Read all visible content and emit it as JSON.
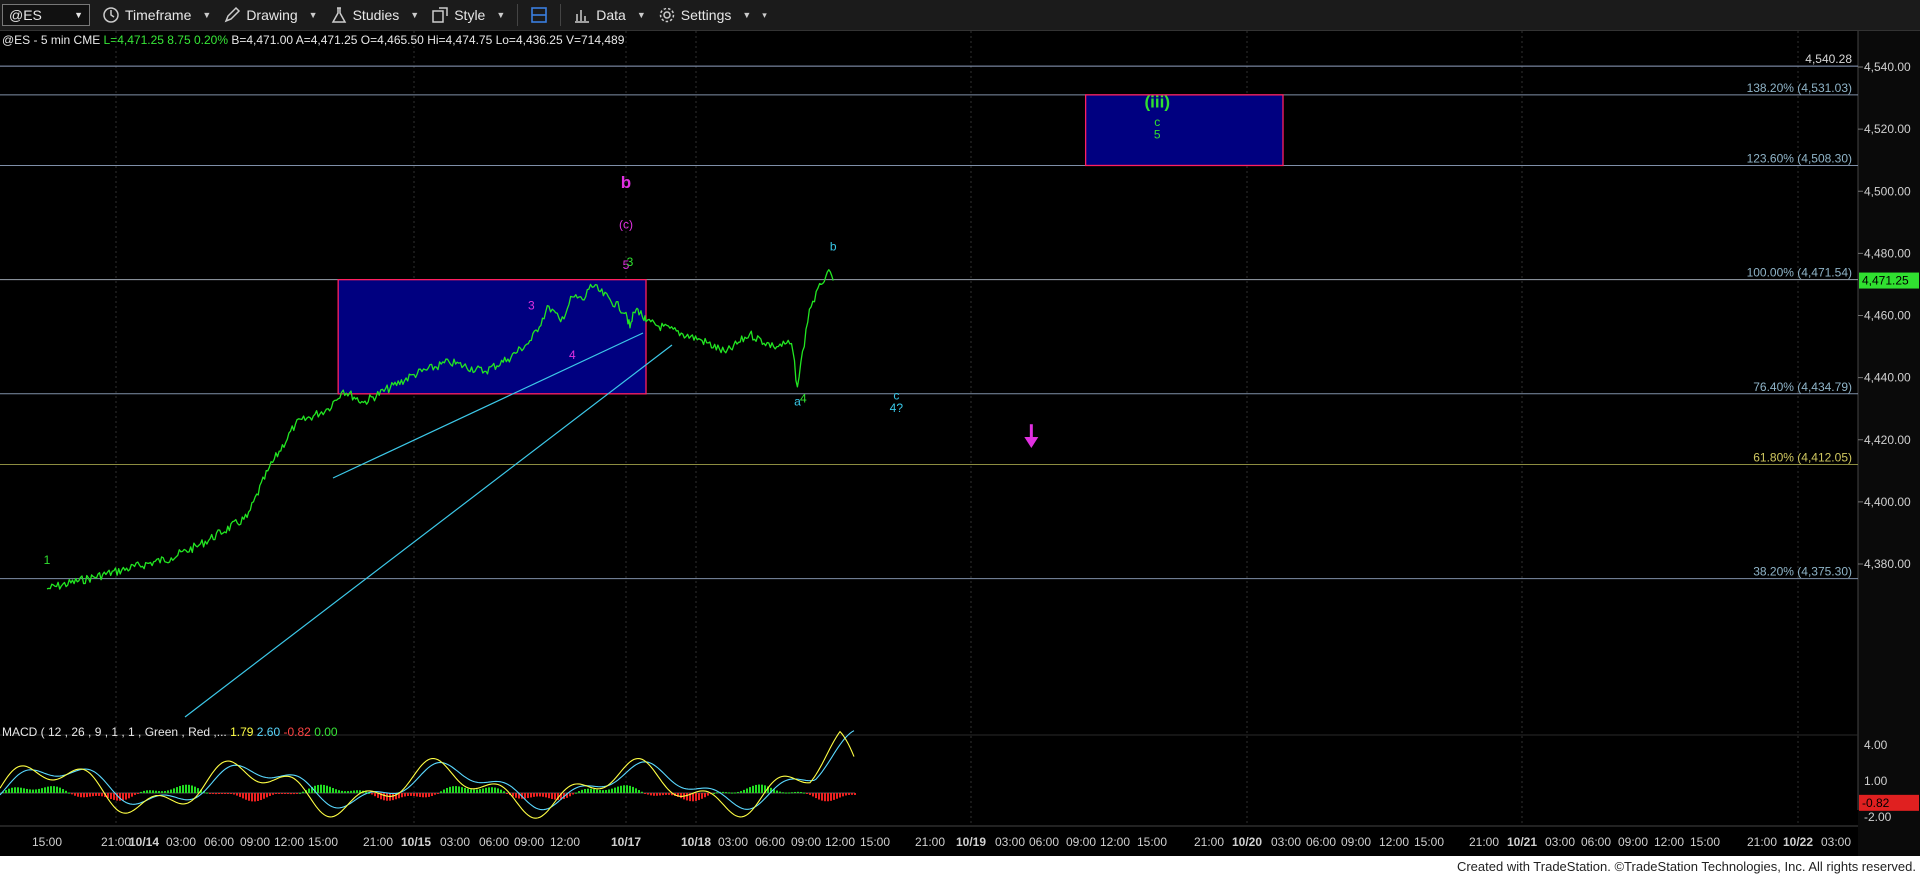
{
  "toolbar": {
    "symbol": "@ES",
    "timeframe": "Timeframe",
    "drawing": "Drawing",
    "studies": "Studies",
    "style": "Style",
    "data": "Data",
    "settings": "Settings"
  },
  "status_line": {
    "parts": [
      {
        "text": "@ES - 5 min  CME",
        "color": "#e8e8e8"
      },
      {
        "text": "L=4,471.25",
        "color": "#37e637"
      },
      {
        "text": "8.75",
        "color": "#37e637"
      },
      {
        "text": "0.20%",
        "color": "#37e637"
      },
      {
        "text": "B=4,471.00",
        "color": "#e8e8e8"
      },
      {
        "text": "A=4,471.25",
        "color": "#e8e8e8"
      },
      {
        "text": "O=4,465.50",
        "color": "#e8e8e8"
      },
      {
        "text": "Hi=4,474.75",
        "color": "#e8e8e8"
      },
      {
        "text": "Lo=4,436.25",
        "color": "#e8e8e8"
      },
      {
        "text": "V=714,489",
        "color": "#e8e8e8"
      }
    ]
  },
  "macd_line": {
    "parts": [
      {
        "text": "MACD ( 12 , 26 , 9 , 1 , 1 , Green , Red ,...",
        "color": "#e8e8e8"
      },
      {
        "text": "1.79",
        "color": "#ffff44"
      },
      {
        "text": "2.60",
        "color": "#5ad8ff"
      },
      {
        "text": "-0.82",
        "color": "#ff4444"
      },
      {
        "text": "0.00",
        "color": "#37e637"
      }
    ]
  },
  "footer": "Created with TradeStation. ©TradeStation Technologies, Inc. All rights reserved.",
  "colors": {
    "price": "#22e622",
    "fib_line": "#7f8fa8",
    "fib_gold": "#8c8c40",
    "wedge": "#3cc8e8",
    "box_fill": "#000080",
    "box_border": "#ff2060",
    "magenta": "#e030e0",
    "green_label": "#30e030",
    "cyan_label": "#38c8e8",
    "macd_line": "#ffff44",
    "macd_signal": "#5ad8ff",
    "hist_pos": "#22dd22",
    "hist_neg": "#ee2020"
  },
  "chart_data": {
    "type": "line",
    "title": "@ES - 5 min CME",
    "price_axis": {
      "ylim": [
        4365,
        4548
      ],
      "ticks": [
        "4,540.00",
        "4,520.00",
        "4,500.00",
        "4,480.00",
        "4,460.00",
        "4,440.00",
        "4,420.00",
        "4,400.00",
        "4,380.00"
      ]
    },
    "last_price": "4,471.25",
    "time_axis_labels": [
      "15:00",
      "21:00",
      "10/14",
      "03:00",
      "06:00",
      "09:00",
      "12:00",
      "15:00",
      "21:00",
      "10/15",
      "03:00",
      "06:00",
      "09:00",
      "12:00",
      "10/17",
      "10/18",
      "03:00",
      "06:00",
      "09:00",
      "12:00",
      "15:00",
      "21:00",
      "10/19",
      "03:00",
      "06:00",
      "09:00",
      "12:00",
      "15:00",
      "21:00",
      "10/20",
      "03:00",
      "06:00",
      "09:00",
      "12:00",
      "15:00",
      "21:00",
      "10/21",
      "03:00",
      "06:00",
      "09:00",
      "12:00",
      "15:00",
      "21:00",
      "10/22",
      "03:00"
    ],
    "series": [
      {
        "name": "@ES",
        "x": [
          "10/13 15:00",
          "10/14 04:00",
          "10/14 06:00",
          "10/14 09:30",
          "10/14 11:00",
          "10/14 13:00",
          "10/14 15:30",
          "10/14 17:00",
          "10/14 19:00",
          "10/15 00:00",
          "10/15 03:00",
          "10/15 06:00",
          "10/15 08:00",
          "10/15 10:00",
          "10/15 11:30",
          "10/15 12:30",
          "10/15 13:30",
          "10/15 14:30",
          "10/15 15:30",
          "10/17 00:00",
          "10/17 01:30",
          "10/17 03:00",
          "10/17 04:30",
          "10/17 06:00",
          "10/17 07:30",
          "10/18 00:30",
          "10/18 02:30",
          "10/18 04:30",
          "10/18 06:30",
          "10/18 08:00",
          "10/18 08:30",
          "10/18 09:30",
          "10/18 10:30",
          "10/18 11:00",
          "10/18 11:30"
        ],
        "values": [
          4372,
          4382,
          4386,
          4395,
          4410,
          4425,
          4430,
          4436,
          4432,
          4441,
          4445,
          4442,
          4446,
          4452,
          4463,
          4458,
          4466,
          4465,
          4470,
          4461,
          4456,
          4461,
          4462,
          4460,
          4458,
          4452,
          4448,
          4454,
          4450,
          4451,
          4437,
          4462,
          4470,
          4474,
          4471.25
        ]
      }
    ],
    "fib_levels": [
      {
        "label": "138.20% (4,531.03)",
        "value": 4531.03
      },
      {
        "label": "123.60% (4,508.30)",
        "value": 4508.3
      },
      {
        "label": "100.00% (4,471.54)",
        "value": 4471.54
      },
      {
        "label": "76.40% (4,434.79)",
        "value": 4434.79
      },
      {
        "label": "61.80% (4,412.05)",
        "value": 4412.05
      },
      {
        "label": "38.20% (4,375.30)",
        "value": 4375.3
      }
    ],
    "hline": {
      "label": "4,540.28",
      "value": 4540.28
    },
    "target_box": {
      "x": [
        "10/19 09:30",
        "10/20 03:00"
      ],
      "y": [
        4508.3,
        4531.03
      ]
    },
    "consolidation_box": {
      "x": [
        "10/14 16:30",
        "10/17 07:30"
      ],
      "y": [
        4434.79,
        4471.54
      ]
    },
    "annotations": [
      {
        "text": "1",
        "x": "10/13 15:00",
        "y": 4380,
        "color": "green"
      },
      {
        "text": "b",
        "x": "10/17 00:00",
        "y": 4501,
        "color": "magenta",
        "size": "large"
      },
      {
        "text": "(c)",
        "x": "10/17 00:00",
        "y": 4488,
        "color": "magenta"
      },
      {
        "text": "5",
        "x": "10/17 00:00",
        "y": 4475,
        "color": "magenta"
      },
      {
        "text": "3",
        "x": "10/17 01:30",
        "y": 4476,
        "color": "green"
      },
      {
        "text": "3",
        "x": "10/15 10:00",
        "y": 4462,
        "color": "magenta"
      },
      {
        "text": "4",
        "x": "10/15 13:30",
        "y": 4446,
        "color": "magenta"
      },
      {
        "text": "b",
        "x": "10/18 11:30",
        "y": 4481,
        "color": "cyan"
      },
      {
        "text": "a",
        "x": "10/18 08:30",
        "y": 4431,
        "color": "cyan"
      },
      {
        "text": "4",
        "x": "10/18 09:00",
        "y": 4432,
        "color": "green"
      },
      {
        "text": "c",
        "x": "10/18 17:00",
        "y": 4433,
        "color": "cyan"
      },
      {
        "text": "4?",
        "x": "10/18 17:00",
        "y": 4429,
        "color": "cyan"
      },
      {
        "text": "(iii)",
        "x": "10/19 15:30",
        "y": 4527,
        "color": "green",
        "size": "large"
      },
      {
        "text": "c",
        "x": "10/19 15:30",
        "y": 4521,
        "color": "green"
      },
      {
        "text": "5",
        "x": "10/19 15:30",
        "y": 4517,
        "color": "green"
      }
    ],
    "arrow": {
      "x": "10/19 05:00",
      "y_from": 4425,
      "y_to": 4418,
      "direction": "down"
    },
    "macd": {
      "ticks": [
        "4.00",
        "1.00",
        "-2.00"
      ],
      "last": "-0.82"
    }
  }
}
